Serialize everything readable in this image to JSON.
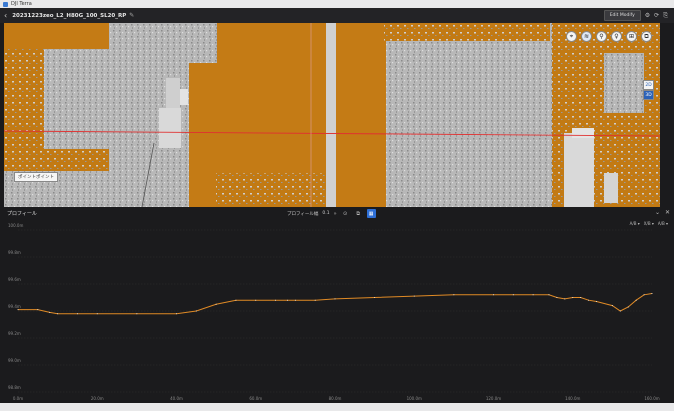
{
  "window": {
    "app_name": "DJI Terra"
  },
  "header": {
    "back_glyph": "‹",
    "file_title": "20231223zeo_L2_H80G_100_SL20_RP",
    "edit_glyph": "✎",
    "edit_mode_label": "Edit Modify",
    "icons": [
      "settings-icon",
      "refresh-icon",
      "export-icon"
    ]
  },
  "viewport": {
    "tools": [
      "measure-icon",
      "layers-icon",
      "pin-icon",
      "filter-icon",
      "camera-icon",
      "share-icon"
    ],
    "tool_glyphs": [
      "⌖",
      "≋",
      "⚲",
      "♀",
      "⊞",
      "⧉"
    ],
    "dim_toggle": {
      "option_2d": "2D",
      "option_3d": "3D",
      "selected": "3D"
    },
    "point_label": "ポイントポイント"
  },
  "profile": {
    "title": "プロフィール",
    "width_label": "プロフィール幅",
    "width_value": "0.1",
    "width_btn_glyph": "»",
    "view_icons": [
      "eye-icon",
      "copy-icon",
      "grid-icon"
    ],
    "view_glyphs": [
      "⊙",
      "⧉",
      "▦"
    ],
    "active_view": 2,
    "header_icons": [
      "chevron-down-icon",
      "close-icon"
    ],
    "header_glyphs": [
      "⌄",
      "✕"
    ],
    "axis_dropdowns": [
      "A/B ▾",
      "X/B ▾",
      "A/B ▾"
    ],
    "accent_color": "#e08a25"
  },
  "chart_data": {
    "type": "line",
    "y_ticks": [
      "100.0m",
      "99.8m",
      "99.6m",
      "99.4m",
      "99.2m",
      "99.0m",
      "98.8m"
    ],
    "x_ticks": [
      "0.0m",
      "20.0m",
      "40.0m",
      "60.0m",
      "80.0m",
      "100.0m",
      "120.0m",
      "140.0m",
      "160.0m"
    ],
    "ylim": [
      98.8,
      100.0
    ],
    "xlim": [
      0,
      160
    ],
    "series": [
      {
        "x": [
          0,
          5,
          8,
          10,
          15,
          20,
          30,
          40,
          45,
          50,
          55,
          60,
          65,
          68,
          70,
          75,
          80,
          90,
          100,
          110,
          120,
          125,
          130,
          134,
          136,
          138,
          140,
          142,
          144,
          146,
          150,
          152,
          154,
          156,
          158,
          160
        ],
        "values": [
          99.41,
          99.41,
          99.39,
          99.38,
          99.38,
          99.38,
          99.38,
          99.38,
          99.4,
          99.45,
          99.48,
          99.48,
          99.48,
          99.48,
          99.48,
          99.48,
          99.49,
          99.5,
          99.51,
          99.52,
          99.52,
          99.52,
          99.52,
          99.52,
          99.5,
          99.49,
          99.5,
          99.5,
          99.48,
          99.47,
          99.44,
          99.4,
          99.43,
          99.48,
          99.52,
          99.53
        ]
      }
    ]
  }
}
